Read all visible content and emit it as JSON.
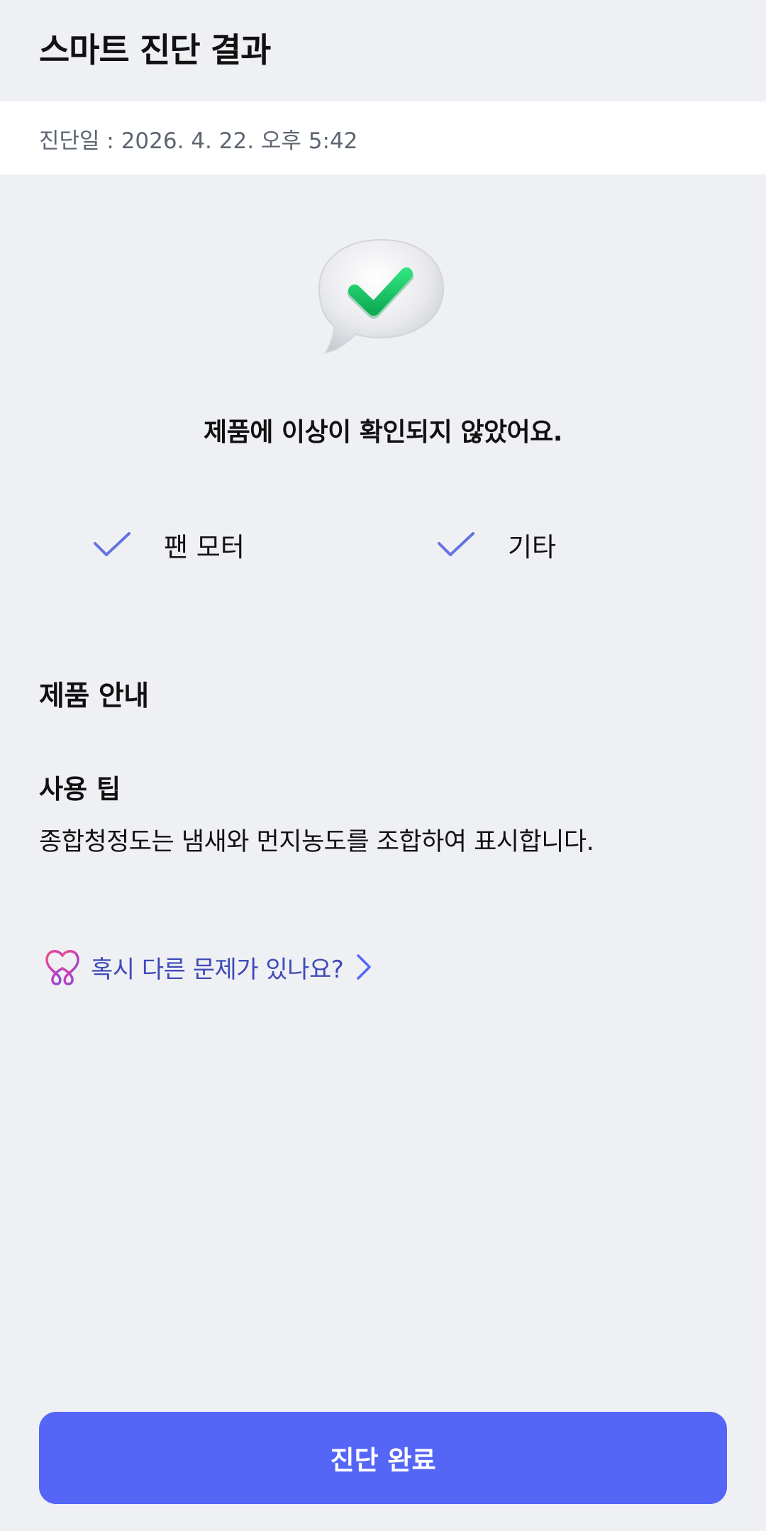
{
  "header": {
    "title": "스마트 진단 결과"
  },
  "diagnosis": {
    "date_text": "진단일 : 2026. 4. 22. 오후 5:42"
  },
  "result": {
    "icon": "speech-bubble-check-icon",
    "message": "제품에 이상이 확인되지 않았어요.",
    "items": [
      {
        "icon": "checkmark-icon",
        "label": "팬 모터"
      },
      {
        "icon": "checkmark-icon",
        "label": "기타"
      }
    ]
  },
  "product_info": {
    "title": "제품 안내",
    "tip_title": "사용 팁",
    "tip_text": "종합청정도는 냄새와 먼지농도를 조합하여 표시합니다."
  },
  "help": {
    "icon": "heart-logo-icon",
    "label": "혹시 다른 문제가 있나요?",
    "chevron": "chevron-right-icon"
  },
  "footer": {
    "complete_label": "진단 완료"
  },
  "colors": {
    "background": "#EFF0F4",
    "accent": "#5566F7",
    "check": "#6574E0",
    "link": "#3F4AB8",
    "success": "#1DC266"
  }
}
